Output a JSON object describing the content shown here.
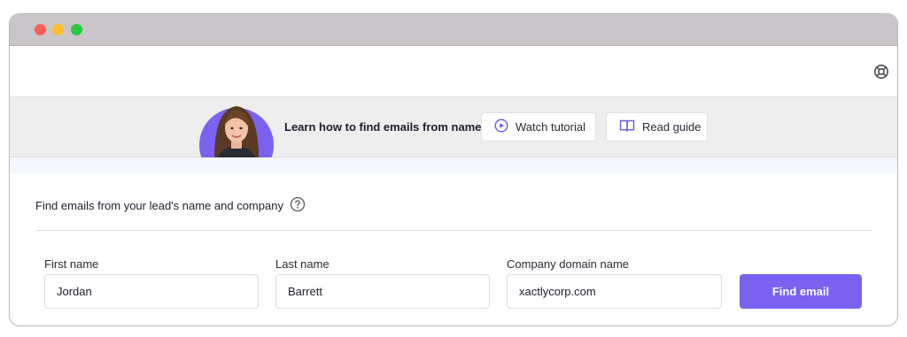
{
  "window": {
    "controls": [
      "close",
      "minimize",
      "maximize"
    ]
  },
  "header": {
    "help_icon": "lifebuoy-icon"
  },
  "banner": {
    "text": "Learn how to find emails from names",
    "watch_tutorial_label": "Watch tutorial",
    "watch_icon": "play-circle-icon",
    "read_guide_label": "Read guide",
    "guide_icon": "book-open-icon",
    "accent_color": "#7b61f0"
  },
  "form": {
    "title": "Find emails from your lead's name and company",
    "help_icon": "question-circle-icon",
    "first_name": {
      "label": "First name",
      "value": "Jordan"
    },
    "last_name": {
      "label": "Last name",
      "value": "Barrett"
    },
    "domain": {
      "label": "Company domain name",
      "value": "xactlycorp.com"
    },
    "submit_label": "Find email",
    "submit_color": "#7b61f0"
  }
}
